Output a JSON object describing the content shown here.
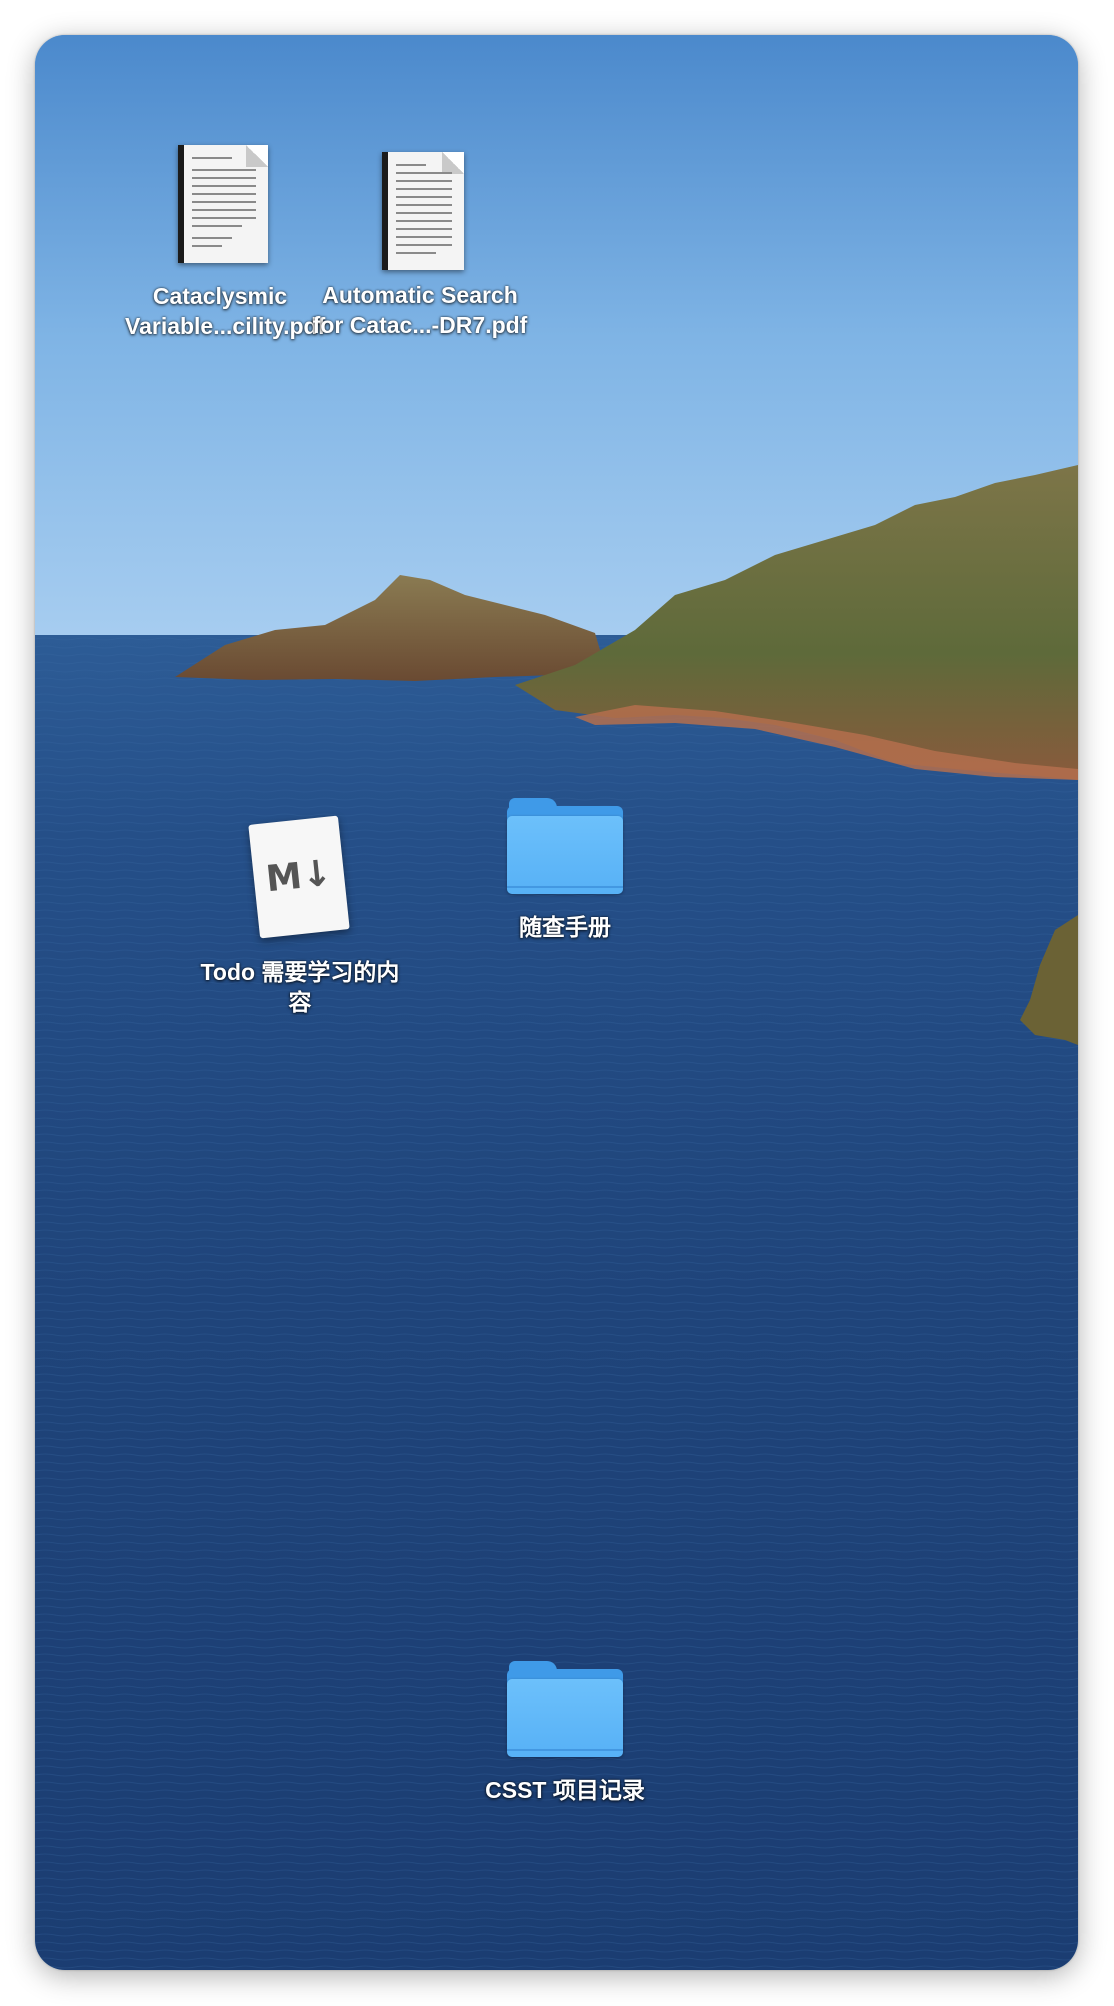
{
  "desktop": {
    "wallpaper": "macOS Catalina island seascape",
    "colors": {
      "sky_top": "#4f8fd0",
      "sky_horizon": "#9dc8ef",
      "sea": "#1f4377",
      "hills": "#7a6a44",
      "folder_blue": "#57b1f6"
    },
    "icons": [
      {
        "label": "Cataclysmic\nVariable...cility.pdf",
        "kind": "pdf-document-icon"
      },
      {
        "label": "Automatic Search\nfor Catac...-DR7.pdf",
        "kind": "pdf-document-icon"
      },
      {
        "label": "Todo 需要学习的内\n容",
        "kind": "markdown-document-icon",
        "glyph": "M↓"
      },
      {
        "label": "随查手册",
        "kind": "folder-icon"
      },
      {
        "label": "CSST 项目记录",
        "kind": "folder-icon"
      }
    ]
  }
}
